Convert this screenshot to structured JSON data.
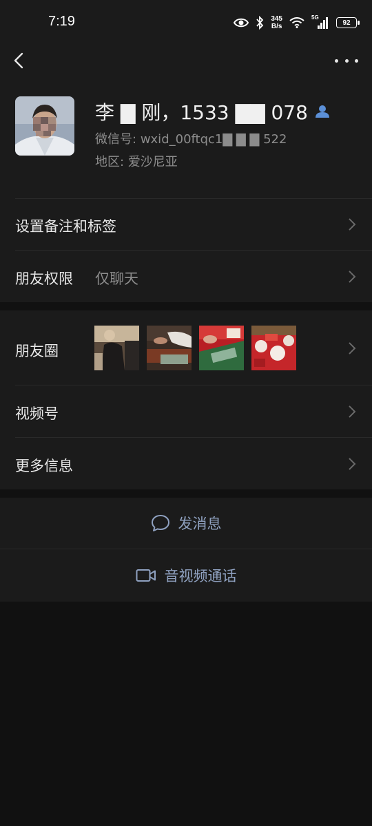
{
  "status_bar": {
    "time": "7:19",
    "net_speed_value": "345",
    "net_speed_unit": "B/s",
    "network_type": "5G",
    "battery": "92",
    "icons": [
      "eye-icon",
      "bluetooth-icon",
      "wifi-icon",
      "signal-icon",
      "battery-icon"
    ]
  },
  "nav": {
    "back_icon": "chevron-left-icon",
    "more_icon": "more-dots-icon"
  },
  "profile": {
    "name": "李 ▇ 刚，1533 ▇▇ 078",
    "wechat_id_label": "微信号:",
    "wechat_id_value": "wxid_00ftqc1▇ ▇ ▇ 522",
    "region_label": "地区:",
    "region_value": "爱沙尼亚",
    "contact_icon": "contact-person-icon"
  },
  "rows": {
    "remark": {
      "label": "设置备注和标签"
    },
    "permissions": {
      "label": "朋友权限",
      "value": "仅聊天"
    },
    "moments": {
      "label": "朋友圈",
      "thumb_count": 4
    },
    "channels": {
      "label": "视频号"
    },
    "more_info": {
      "label": "更多信息"
    }
  },
  "actions": {
    "send_message": {
      "label": "发消息",
      "icon": "chat-bubble-icon"
    },
    "av_call": {
      "label": "音视频通话",
      "icon": "video-camera-icon"
    }
  },
  "colors": {
    "background": "#111111",
    "card": "#1b1b1b",
    "action_text": "#8fa1c0",
    "secondary_text": "#8c8c8c",
    "contact_icon": "#5b8fd6"
  }
}
